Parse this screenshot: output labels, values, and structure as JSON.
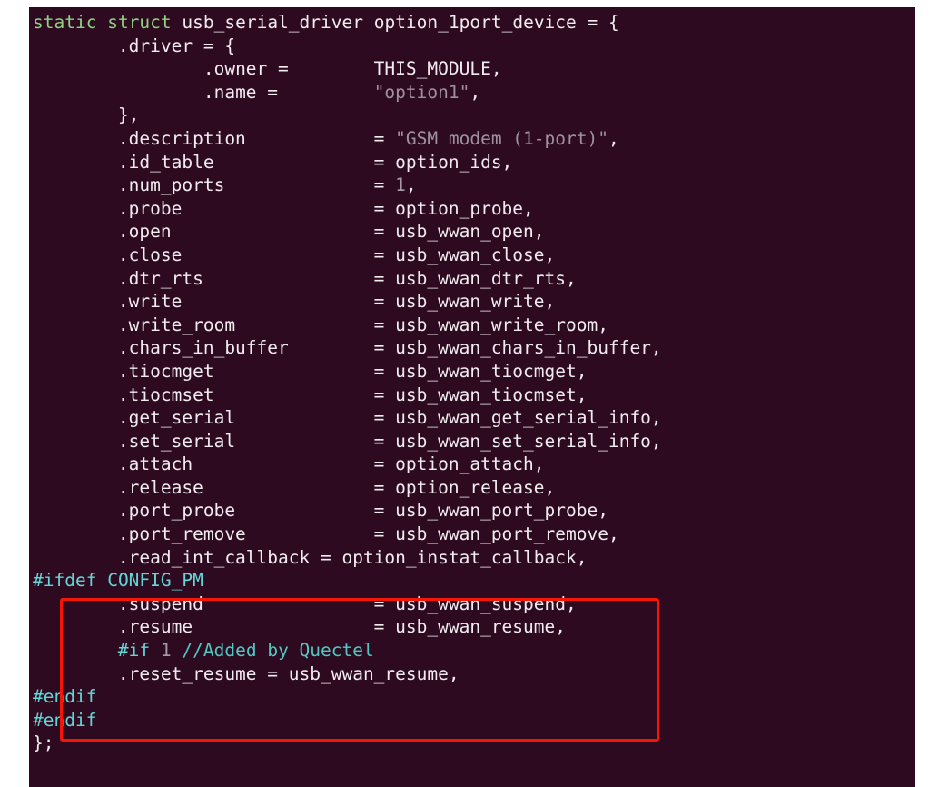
{
  "window": {
    "app": "terminal",
    "background_color": "#2d0a20",
    "foreground_color": "#e8e4e8"
  },
  "theme": {
    "keyword_color": "#8fd27f",
    "preprocessor_color": "#62d6d6",
    "comment_color": "#4fc9c2",
    "string_color": "#9f91a0",
    "number_color": "#a79aa8",
    "identifier_color": "#f0ecf0",
    "annotation_color": "#f41707"
  },
  "annotation": {
    "shape": "rectangle",
    "color": "#f41707",
    "label": "highlighted-config-pm-block"
  },
  "code": {
    "language": "c",
    "lines": [
      {
        "n": 1,
        "text": "static struct usb_serial_driver option_1port_device = {"
      },
      {
        "n": 2,
        "text": "        .driver = {"
      },
      {
        "n": 3,
        "text": "                .owner =        THIS_MODULE,"
      },
      {
        "n": 4,
        "text": "                .name =         \"option1\","
      },
      {
        "n": 5,
        "text": "        },"
      },
      {
        "n": 6,
        "text": "        .description            = \"GSM modem (1-port)\","
      },
      {
        "n": 7,
        "text": "        .id_table               = option_ids,"
      },
      {
        "n": 8,
        "text": "        .num_ports              = 1,"
      },
      {
        "n": 9,
        "text": "        .probe                  = option_probe,"
      },
      {
        "n": 10,
        "text": "        .open                   = usb_wwan_open,"
      },
      {
        "n": 11,
        "text": "        .close                  = usb_wwan_close,"
      },
      {
        "n": 12,
        "text": "        .dtr_rts                = usb_wwan_dtr_rts,"
      },
      {
        "n": 13,
        "text": "        .write                  = usb_wwan_write,"
      },
      {
        "n": 14,
        "text": "        .write_room             = usb_wwan_write_room,"
      },
      {
        "n": 15,
        "text": "        .chars_in_buffer        = usb_wwan_chars_in_buffer,"
      },
      {
        "n": 16,
        "text": "        .tiocmget               = usb_wwan_tiocmget,"
      },
      {
        "n": 17,
        "text": "        .tiocmset               = usb_wwan_tiocmset,"
      },
      {
        "n": 18,
        "text": "        .get_serial             = usb_wwan_get_serial_info,"
      },
      {
        "n": 19,
        "text": "        .set_serial             = usb_wwan_set_serial_info,"
      },
      {
        "n": 20,
        "text": "        .attach                 = option_attach,"
      },
      {
        "n": 21,
        "text": "        .release                = option_release,"
      },
      {
        "n": 22,
        "text": "        .port_probe             = usb_wwan_port_probe,"
      },
      {
        "n": 23,
        "text": "        .port_remove            = usb_wwan_port_remove,"
      },
      {
        "n": 24,
        "text": "        .read_int_callback = option_instat_callback,"
      },
      {
        "n": 25,
        "text": "#ifdef CONFIG_PM"
      },
      {
        "n": 26,
        "text": "        .suspend                = usb_wwan_suspend,"
      },
      {
        "n": 27,
        "text": "        .resume                 = usb_wwan_resume,"
      },
      {
        "n": 28,
        "text": "        #if 1 //Added by Quectel"
      },
      {
        "n": 29,
        "text": "        .reset_resume = usb_wwan_resume,"
      },
      {
        "n": 30,
        "text": "#endif"
      },
      {
        "n": 31,
        "text": "#endif"
      },
      {
        "n": 32,
        "text": "};"
      }
    ],
    "tokens": {
      "keywords": [
        "static",
        "struct"
      ],
      "preprocessor": [
        "#ifdef",
        "#if",
        "#endif"
      ],
      "comments": [
        "//Added by Quectel"
      ],
      "strings": [
        "\"option1\"",
        "\"GSM modem (1-port)\""
      ],
      "numbers": [
        "1"
      ],
      "struct_name": "option_1port_device",
      "struct_type": "usb_serial_driver",
      "config_macro": "CONFIG_PM",
      "members": [
        ".driver",
        ".owner",
        ".name",
        ".description",
        ".id_table",
        ".num_ports",
        ".probe",
        ".open",
        ".close",
        ".dtr_rts",
        ".write",
        ".write_room",
        ".chars_in_buffer",
        ".tiocmget",
        ".tiocmset",
        ".get_serial",
        ".set_serial",
        ".attach",
        ".release",
        ".port_probe",
        ".port_remove",
        ".read_int_callback",
        ".suspend",
        ".resume",
        ".reset_resume"
      ],
      "values": [
        "THIS_MODULE",
        "option_ids",
        "option_probe",
        "usb_wwan_open",
        "usb_wwan_close",
        "usb_wwan_dtr_rts",
        "usb_wwan_write",
        "usb_wwan_write_room",
        "usb_wwan_chars_in_buffer",
        "usb_wwan_tiocmget",
        "usb_wwan_tiocmset",
        "usb_wwan_get_serial_info",
        "usb_wwan_set_serial_info",
        "option_attach",
        "option_release",
        "usb_wwan_port_probe",
        "usb_wwan_port_remove",
        "option_instat_callback",
        "usb_wwan_suspend",
        "usb_wwan_resume"
      ]
    }
  }
}
